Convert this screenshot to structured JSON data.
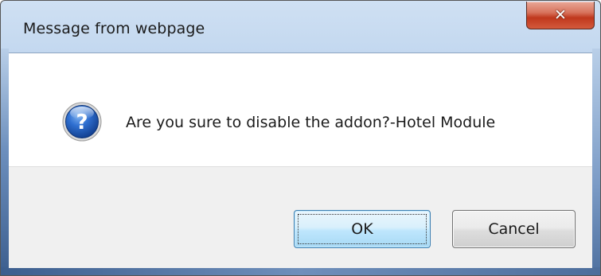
{
  "dialog": {
    "title": "Message from webpage",
    "close_icon": "close-icon",
    "message_icon": "question-icon",
    "message": "Are you sure to disable the addon?-Hotel Module",
    "buttons": {
      "ok_label": "OK",
      "cancel_label": "Cancel"
    }
  },
  "colors": {
    "title_bar": "#b9d1ec",
    "close_button": "#c0381d",
    "ok_button_border": "#3c7fb1",
    "icon_blue": "#1f5fbf"
  }
}
